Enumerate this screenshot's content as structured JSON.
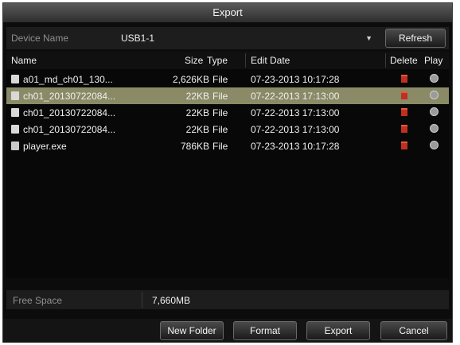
{
  "window": {
    "title": "Export"
  },
  "device": {
    "label": "Device Name",
    "value": "USB1-1",
    "refresh_label": "Refresh"
  },
  "table": {
    "columns": {
      "name": "Name",
      "size": "Size",
      "type": "Type",
      "edit_date": "Edit Date",
      "delete": "Delete",
      "play": "Play"
    },
    "rows": [
      {
        "name": "a01_md_ch01_130...",
        "size": "2,626KB",
        "type": "File",
        "date": "07-23-2013 10:17:28",
        "selected": false
      },
      {
        "name": "ch01_20130722084...",
        "size": "22KB",
        "type": "File",
        "date": "07-22-2013 17:13:00",
        "selected": true
      },
      {
        "name": "ch01_20130722084...",
        "size": "22KB",
        "type": "File",
        "date": "07-22-2013 17:13:00",
        "selected": false
      },
      {
        "name": "ch01_20130722084...",
        "size": "22KB",
        "type": "File",
        "date": "07-22-2013 17:13:00",
        "selected": false
      },
      {
        "name": "player.exe",
        "size": "786KB",
        "type": "File",
        "date": "07-23-2013 10:17:28",
        "selected": false
      }
    ]
  },
  "free_space": {
    "label": "Free Space",
    "value": "7,660MB"
  },
  "footer": {
    "new_folder": "New Folder",
    "format": "Format",
    "export": "Export",
    "cancel": "Cancel"
  },
  "icons": {
    "file": "file-icon",
    "delete": "trash-icon",
    "play": "play-icon",
    "dropdown": "chevron-down-icon"
  },
  "colors": {
    "selected_row": "#8a8a66",
    "delete_icon": "#c03020"
  }
}
